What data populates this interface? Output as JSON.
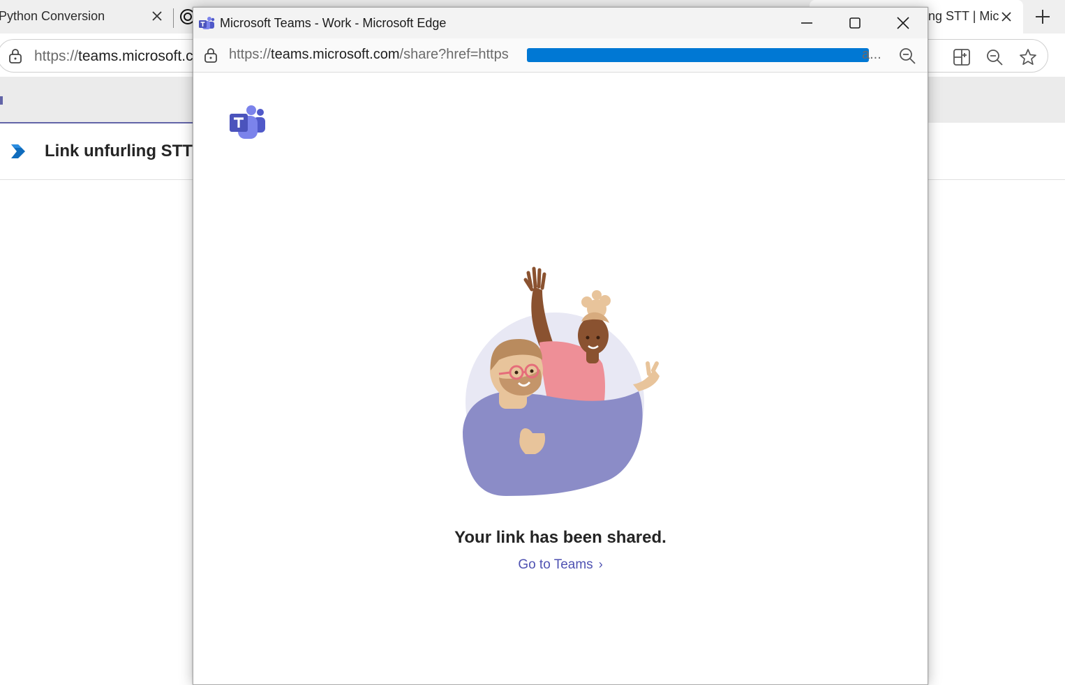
{
  "background_browser": {
    "tabs": [
      {
        "label": "Python Conversion"
      },
      {
        "label": "ng STT | Mic"
      }
    ],
    "address": {
      "prefix": "https://",
      "host": "teams.microsoft.c"
    },
    "page_title": "Link unfurling STT"
  },
  "popup": {
    "window_title": "Microsoft Teams - Work - Microsoft Edge",
    "address": {
      "prefix": "https://",
      "host": "teams.microsoft.com",
      "path": "/share?href=https",
      "ellipsis": "a..."
    },
    "message": "Your link has been shared.",
    "link_label": "Go to Teams",
    "link_chevron": "›"
  },
  "colors": {
    "teams_purple": "#6264a7",
    "link_color": "#4f52b2",
    "redaction_blue": "#0078d4"
  }
}
